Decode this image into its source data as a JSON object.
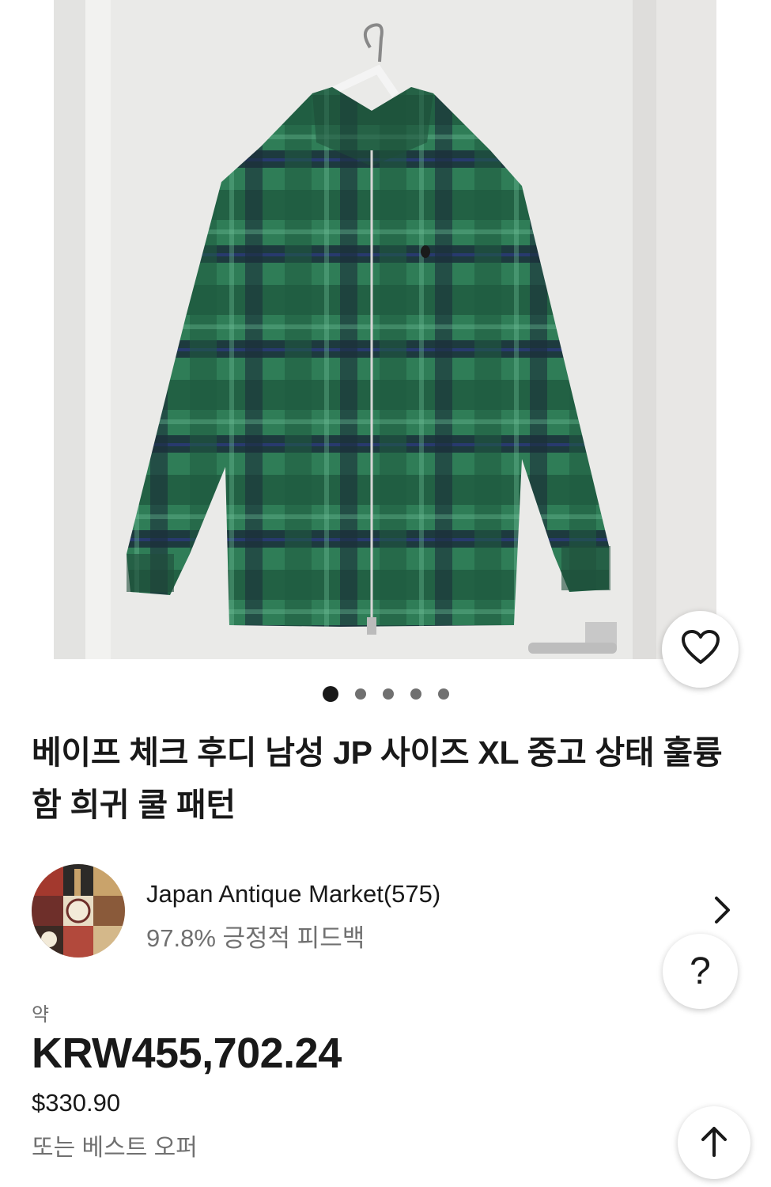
{
  "product": {
    "title": "베이프 체크 후디 남성 JP 사이즈 XL 중고 상태 훌륭함 희귀 쿨 패턴",
    "image_count": 5,
    "active_image": 1
  },
  "seller": {
    "name": "Japan Antique Market(575)",
    "feedback": "97.8% 긍정적 피드백"
  },
  "pricing": {
    "approx_label": "약",
    "price_krw": "KRW455,702.24",
    "price_usd": "$330.90",
    "best_offer": "또는 베스트 오퍼"
  },
  "icons": {
    "favorite": "heart-icon",
    "help": "question-icon",
    "back_to_top": "arrow-up-icon",
    "seller_link": "chevron-right-icon"
  },
  "help_symbol": "?",
  "colors": {
    "text_primary": "#191919",
    "text_secondary": "#707070",
    "jacket_green": "#2e7a55"
  }
}
